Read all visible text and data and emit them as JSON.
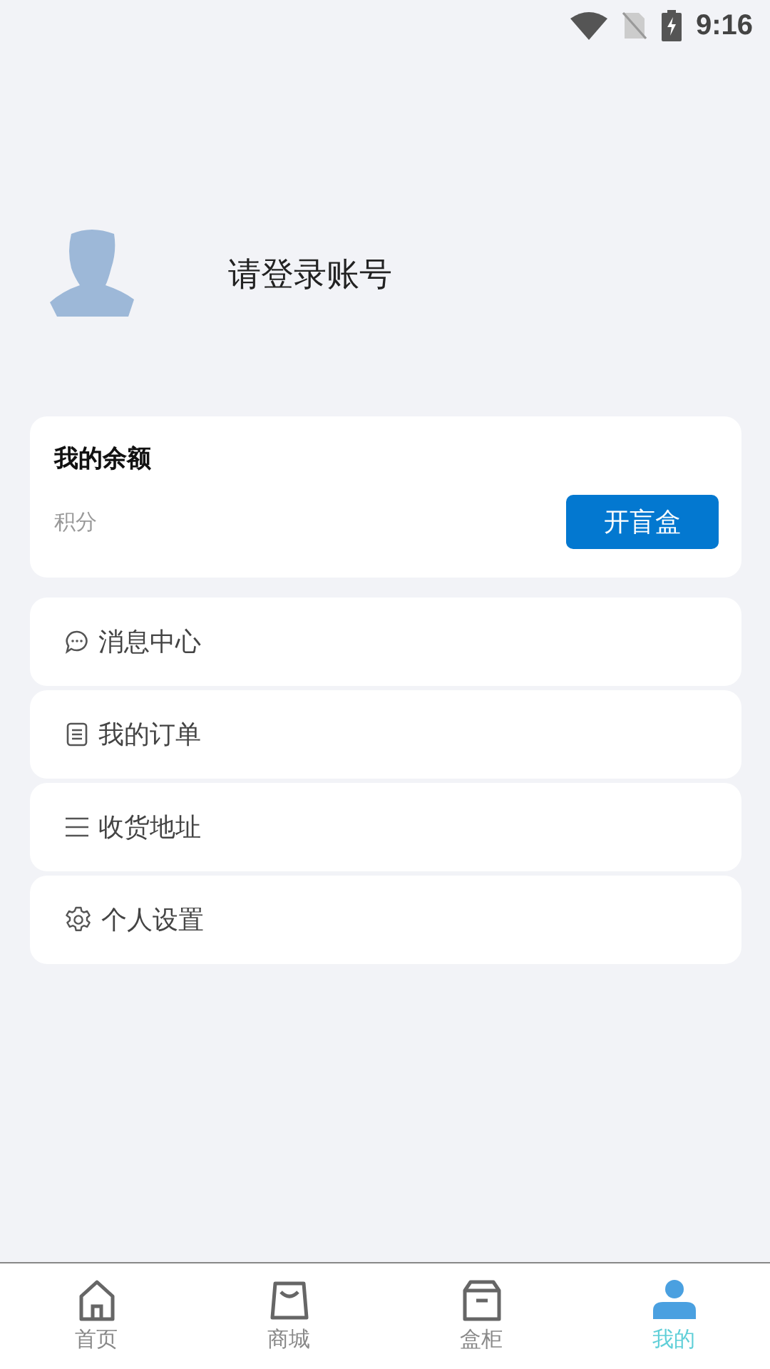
{
  "status_bar": {
    "time": "9:16"
  },
  "profile": {
    "prompt": "请登录账号"
  },
  "balance_card": {
    "title": "我的余额",
    "points_label": "积分",
    "button": "开盲盒"
  },
  "menu": [
    {
      "label": "消息中心"
    },
    {
      "label": "我的订单"
    },
    {
      "label": "收货地址"
    },
    {
      "label": "个人设置"
    }
  ],
  "tab_bar": [
    {
      "label": "首页",
      "selected": false
    },
    {
      "label": "商城",
      "selected": false
    },
    {
      "label": "盒柜",
      "selected": false
    },
    {
      "label": "我的",
      "selected": true
    }
  ]
}
